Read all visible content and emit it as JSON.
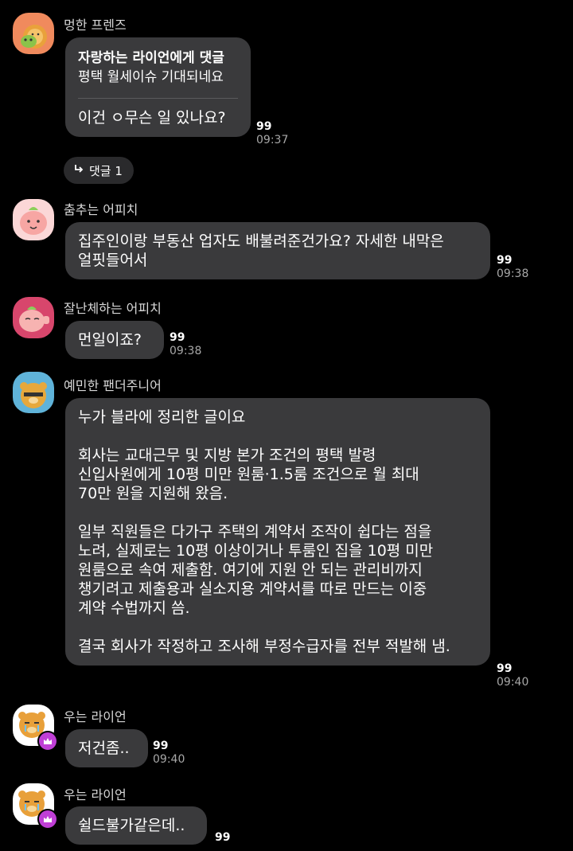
{
  "messages": [
    {
      "sender": "멍한 프렌즈",
      "reply_title": "자랑하는 라이언에게 댓글",
      "reply_quote": "평택 월세이슈 기대되네요",
      "text": "이건 ㅇ무슨 일 있나요?",
      "count": "99",
      "time": "09:37",
      "thread_label": "댓글 1"
    },
    {
      "sender": "춤추는 어피치",
      "lines": [
        "집주인이랑 부동산 업자도 배불려준건가요? 자세한 내막은",
        "얼핏들어서"
      ],
      "count": "99",
      "time": "09:38"
    },
    {
      "sender": "잘난체하는 어피치",
      "lines": [
        "먼일이죠?"
      ],
      "count": "99",
      "time": "09:38"
    },
    {
      "sender": "예민한 팬더주니어",
      "lines": [
        "누가 블라에 정리한 글이요",
        "",
        "회사는 교대근무 및 지방 본가 조건의 평택 발령",
        "신입사원에게 10평 미만 원룸·1.5룸 조건으로 월 최대",
        "70만 원을 지원해 왔음.",
        "",
        "일부 직원들은 다가구 주택의 계약서 조작이 쉽다는 점을",
        "노려, 실제로는 10평 이상이거나 투룸인 집을 10평 미만",
        "원룸으로 속여 제출함. 여기에 지원 안 되는 관리비까지",
        "챙기려고 제출용과 실소지용 계약서를 따로 만드는 이중",
        "계약 수법까지 씀.",
        "",
        "결국 회사가 작정하고 조사해 부정수급자를 전부 적발해 냄."
      ],
      "count": "99",
      "time": "09:40"
    },
    {
      "sender": "우는 라이언",
      "lines": [
        "저건좀.."
      ],
      "count": "99",
      "time": "09:40"
    },
    {
      "sender": "우는 라이언",
      "lines": [
        "쉴드불가같은데.."
      ],
      "count": "99",
      "time": ""
    }
  ],
  "colors": {
    "background": "#000000",
    "bubble": "#3a3a3c",
    "crown_badge": "#c03fd6"
  }
}
